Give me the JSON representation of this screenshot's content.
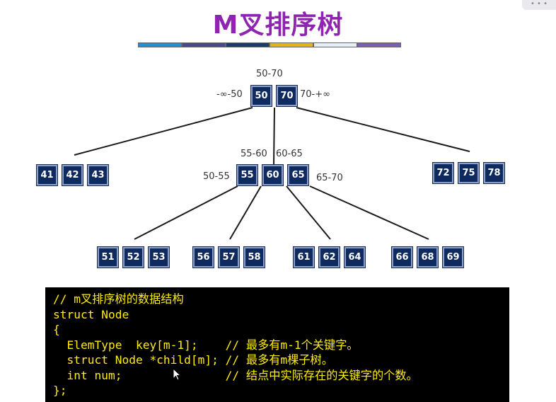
{
  "title": "M叉排序树",
  "color_bar": [
    "#1e90d8",
    "#4a4a8a",
    "#1c3a6a",
    "#e8b020",
    "#e8eef8",
    "#7a60b0"
  ],
  "tree": {
    "root": {
      "keys": [
        "50",
        "70"
      ],
      "top_label": "50-70",
      "left_label": "-∞-50",
      "right_label": "70-+∞"
    },
    "level1": [
      {
        "keys": [
          "41",
          "42",
          "43"
        ]
      },
      {
        "keys": [
          "55",
          "60",
          "65"
        ],
        "labels": [
          "55-60",
          "60-65",
          "50-55",
          "65-70"
        ]
      },
      {
        "keys": [
          "72",
          "75",
          "78"
        ]
      }
    ],
    "level2": [
      {
        "keys": [
          "51",
          "52",
          "53"
        ]
      },
      {
        "keys": [
          "56",
          "57",
          "58"
        ]
      },
      {
        "keys": [
          "61",
          "62",
          "64"
        ]
      },
      {
        "keys": [
          "66",
          "68",
          "69"
        ]
      }
    ]
  },
  "code_lines": [
    "// m叉排序树的数据结构",
    "struct Node",
    "{",
    "  ElemType  key[m-1];    // 最多有m-1个关键字。",
    "  struct Node *child[m]; // 最多有m棵子树。",
    "  int num;               // 结点中实际存在的关键字的个数。",
    "};"
  ]
}
